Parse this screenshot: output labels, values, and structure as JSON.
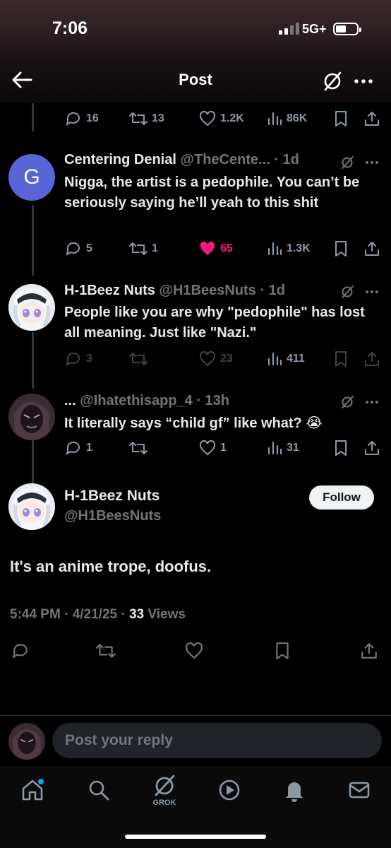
{
  "status_bar": {
    "time": "7:06",
    "network": "5G+"
  },
  "header": {
    "title": "Post"
  },
  "prev_actions": {
    "replies": "16",
    "reposts": "13",
    "likes": "1.2K",
    "views": "86K"
  },
  "replies": [
    {
      "name": "Centering Denial",
      "handle": "@TheCente...",
      "time": "· 1d",
      "avatar_letter": "G",
      "text": "Nigga, the artist is a pedophile. You can’t be seriously saying he’ll yeah to this shit",
      "replies": "5",
      "reposts": "1",
      "likes": "65",
      "views": "1.3K"
    },
    {
      "name": "H-1Beez Nuts",
      "handle": "@H1BeesNuts",
      "time": "· 1d",
      "text": "People like you are why \"pedophile\" has lost all meaning. Just like \"Nazi.\"",
      "replies": "3",
      "reposts": "",
      "likes": "23",
      "views": "411"
    },
    {
      "name": "...",
      "handle": "@Ihatethisapp_4",
      "time": "· 13h",
      "text": "It literally says “child gf” like what? 😭",
      "replies": "1",
      "reposts": "",
      "likes": "1",
      "views": "31"
    }
  ],
  "main_post": {
    "name": "H-1Beez Nuts",
    "handle": "@H1BeesNuts",
    "follow_label": "Follow",
    "text": "It's an anime trope, doofus.",
    "timestamp": "5:44 PM · 4/21/25 ·",
    "views_count": "33",
    "views_label": "Views"
  },
  "reply_bar": {
    "placeholder": "Post your reply"
  },
  "bottom_nav": {
    "grok_label": "GROK"
  },
  "colors": {
    "like_active": "#f91880",
    "avatar_g": "#5865d6",
    "muted": "#71767b"
  },
  "icons": [
    "back-arrow-icon",
    "grok-icon",
    "more-icon",
    "reply-icon",
    "repost-icon",
    "like-icon",
    "views-icon",
    "bookmark-icon",
    "share-icon",
    "home-icon",
    "search-icon",
    "video-icon",
    "notifications-icon",
    "messages-icon"
  ]
}
